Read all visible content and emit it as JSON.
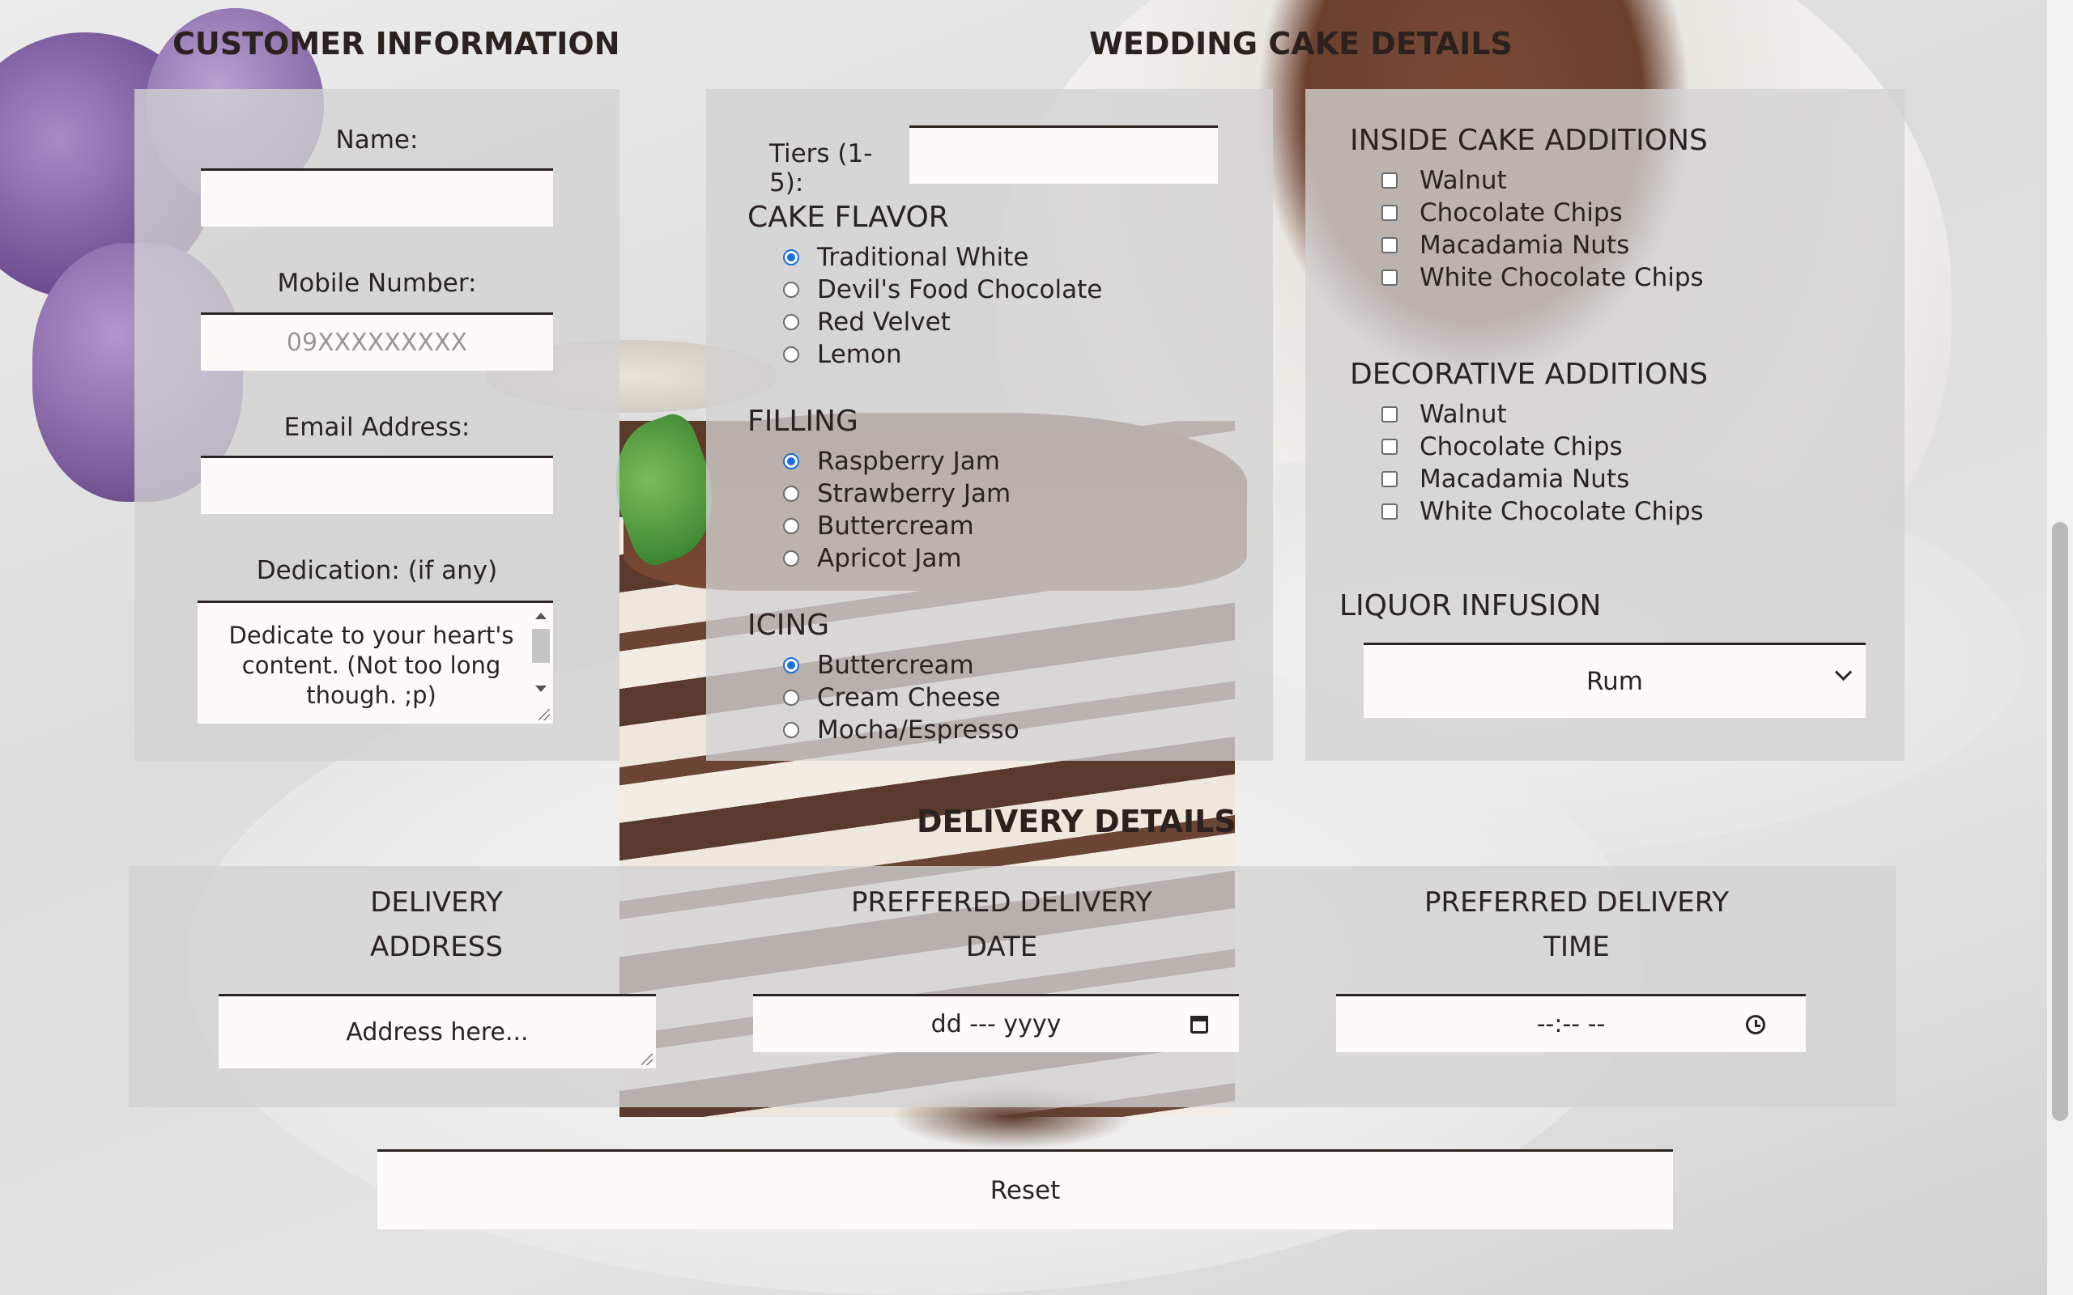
{
  "headings": {
    "customer": "CUSTOMER INFORMATION",
    "cake": "WEDDING CAKE DETAILS",
    "delivery": "DELIVERY DETAILS"
  },
  "customer": {
    "name_label": "Name:",
    "name_value": "",
    "mobile_label": "Mobile Number:",
    "mobile_placeholder": "09XXXXXXXXX",
    "email_label": "Email Address:",
    "email_value": "",
    "dedication_label": "Dedication: (if any)",
    "dedication_placeholder": "Dedicate to your heart's content. (Not too long though. ;p)"
  },
  "cake": {
    "tiers_label": "Tiers (1-5):",
    "tiers_value": "",
    "flavor_title": "CAKE FLAVOR",
    "flavors": [
      {
        "label": "Traditional White",
        "selected": true
      },
      {
        "label": "Devil's Food Chocolate",
        "selected": false
      },
      {
        "label": "Red Velvet",
        "selected": false
      },
      {
        "label": "Lemon",
        "selected": false
      }
    ],
    "filling_title": "FILLING",
    "fillings": [
      {
        "label": "Raspberry Jam",
        "selected": true
      },
      {
        "label": "Strawberry Jam",
        "selected": false
      },
      {
        "label": "Buttercream",
        "selected": false
      },
      {
        "label": "Apricot Jam",
        "selected": false
      }
    ],
    "icing_title": "ICING",
    "icings": [
      {
        "label": "Buttercream",
        "selected": true
      },
      {
        "label": "Cream Cheese",
        "selected": false
      },
      {
        "label": "Mocha/Espresso",
        "selected": false
      }
    ]
  },
  "additions": {
    "inside_title": "INSIDE CAKE ADDITIONS",
    "inside": [
      {
        "label": "Walnut",
        "checked": false
      },
      {
        "label": "Chocolate Chips",
        "checked": false
      },
      {
        "label": "Macadamia Nuts",
        "checked": false
      },
      {
        "label": "White Chocolate Chips",
        "checked": false
      }
    ],
    "decorative_title": "DECORATIVE ADDITIONS",
    "decorative": [
      {
        "label": "Walnut",
        "checked": false
      },
      {
        "label": "Chocolate Chips",
        "checked": false
      },
      {
        "label": "Macadamia Nuts",
        "checked": false
      },
      {
        "label": "White Chocolate Chips",
        "checked": false
      }
    ],
    "liquor_title": "LIQUOR INFUSION",
    "liquor_selected": "Rum"
  },
  "delivery": {
    "address_label_1": "DELIVERY",
    "address_label_2": "ADDRESS",
    "address_placeholder": "Address here...",
    "date_label_1": "PREFFERED DELIVERY",
    "date_label_2": "DATE",
    "date_placeholder": "dd --- yyyy",
    "time_label_1": "PREFERRED DELIVERY",
    "time_label_2": "TIME",
    "time_placeholder": "--:-- --"
  },
  "actions": {
    "reset_label": "Reset"
  },
  "colors": {
    "accent": "#1a6fe0",
    "panel": "#d2d2d2",
    "field": "#fdfaf7",
    "text": "#2a2320"
  }
}
